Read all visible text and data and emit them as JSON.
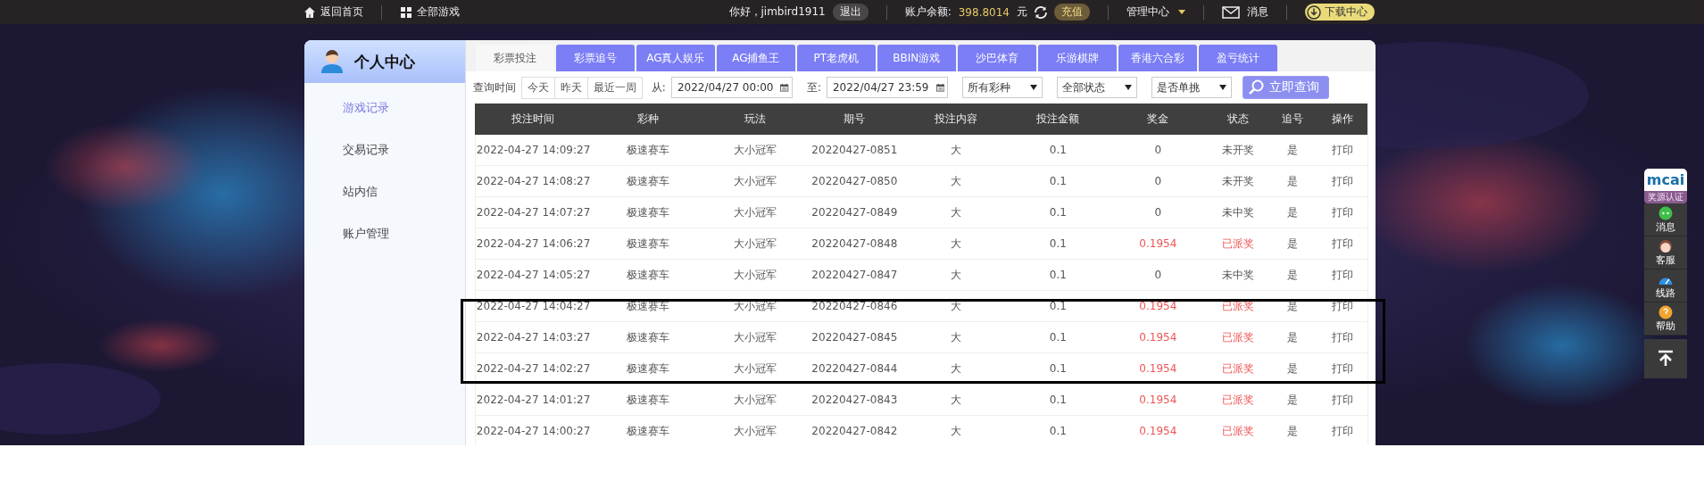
{
  "topbar": {
    "home": "返回首页",
    "all_games": "全部游戏",
    "greeting": "你好，jimbird1911",
    "logout": "退出",
    "balance_label": "账户余额:",
    "balance": "398.8014",
    "currency": "元",
    "recharge": "充值",
    "manage": "管理中心",
    "messages": "消息",
    "download": "下载中心"
  },
  "sidebar": {
    "title": "个人中心",
    "items": [
      {
        "label": "游戏记录",
        "selected": true
      },
      {
        "label": "交易记录",
        "selected": false
      },
      {
        "label": "站内信",
        "selected": false
      },
      {
        "label": "账户管理",
        "selected": false
      }
    ]
  },
  "tabs": [
    {
      "label": "彩票投注",
      "selected": true
    },
    {
      "label": "彩票追号",
      "selected": false
    },
    {
      "label": "AG真人娱乐",
      "selected": false
    },
    {
      "label": "AG捕鱼王",
      "selected": false
    },
    {
      "label": "PT老虎机",
      "selected": false
    },
    {
      "label": "BBIN游戏",
      "selected": false
    },
    {
      "label": "沙巴体育",
      "selected": false
    },
    {
      "label": "乐游棋牌",
      "selected": false
    },
    {
      "label": "香港六合彩",
      "selected": false
    },
    {
      "label": "盈亏统计",
      "selected": false
    }
  ],
  "filter": {
    "label": "查询时间",
    "quick": [
      "今天",
      "昨天",
      "最近一周"
    ],
    "from_label": "从:",
    "from": "2022/04/27 00:00",
    "to_label": "至:",
    "to": "2022/04/27 23:59",
    "selects": [
      "所有彩种",
      "全部状态",
      "是否单挑"
    ],
    "search": "立即查询"
  },
  "table": {
    "columns": [
      "投注时间",
      "彩种",
      "玩法",
      "期号",
      "投注内容",
      "投注金额",
      "奖金",
      "状态",
      "追号",
      "操作"
    ],
    "rows": [
      {
        "time": "2022-04-27 14:09:27",
        "lottery": "极速赛车",
        "play": "大小冠军",
        "issue": "20220427-0851",
        "content": "大",
        "amount": "0.1",
        "prize": "0",
        "status": "未开奖",
        "chase": "是",
        "action": "打印",
        "paid": false
      },
      {
        "time": "2022-04-27 14:08:27",
        "lottery": "极速赛车",
        "play": "大小冠军",
        "issue": "20220427-0850",
        "content": "大",
        "amount": "0.1",
        "prize": "0",
        "status": "未开奖",
        "chase": "是",
        "action": "打印",
        "paid": false
      },
      {
        "time": "2022-04-27 14:07:27",
        "lottery": "极速赛车",
        "play": "大小冠军",
        "issue": "20220427-0849",
        "content": "大",
        "amount": "0.1",
        "prize": "0",
        "status": "未中奖",
        "chase": "是",
        "action": "打印",
        "paid": false
      },
      {
        "time": "2022-04-27 14:06:27",
        "lottery": "极速赛车",
        "play": "大小冠军",
        "issue": "20220427-0848",
        "content": "大",
        "amount": "0.1",
        "prize": "0.1954",
        "status": "已派奖",
        "chase": "是",
        "action": "打印",
        "paid": true
      },
      {
        "time": "2022-04-27 14:05:27",
        "lottery": "极速赛车",
        "play": "大小冠军",
        "issue": "20220427-0847",
        "content": "大",
        "amount": "0.1",
        "prize": "0",
        "status": "未中奖",
        "chase": "是",
        "action": "打印",
        "paid": false
      },
      {
        "time": "2022-04-27 14:04:27",
        "lottery": "极速赛车",
        "play": "大小冠军",
        "issue": "20220427-0846",
        "content": "大",
        "amount": "0.1",
        "prize": "0.1954",
        "status": "已派奖",
        "chase": "是",
        "action": "打印",
        "paid": true
      },
      {
        "time": "2022-04-27 14:03:27",
        "lottery": "极速赛车",
        "play": "大小冠军",
        "issue": "20220427-0845",
        "content": "大",
        "amount": "0.1",
        "prize": "0.1954",
        "status": "已派奖",
        "chase": "是",
        "action": "打印",
        "paid": true
      },
      {
        "time": "2022-04-27 14:02:27",
        "lottery": "极速赛车",
        "play": "大小冠军",
        "issue": "20220427-0844",
        "content": "大",
        "amount": "0.1",
        "prize": "0.1954",
        "status": "已派奖",
        "chase": "是",
        "action": "打印",
        "paid": true
      },
      {
        "time": "2022-04-27 14:01:27",
        "lottery": "极速赛车",
        "play": "大小冠军",
        "issue": "20220427-0843",
        "content": "大",
        "amount": "0.1",
        "prize": "0.1954",
        "status": "已派奖",
        "chase": "是",
        "action": "打印",
        "paid": true
      },
      {
        "time": "2022-04-27 14:00:27",
        "lottery": "极速赛车",
        "play": "大小冠军",
        "issue": "20220427-0842",
        "content": "大",
        "amount": "0.1",
        "prize": "0.1954",
        "status": "已派奖",
        "chase": "是",
        "action": "打印",
        "paid": true
      }
    ]
  },
  "float_bar": {
    "logo": "mcai",
    "badge": "奖源认证",
    "items": [
      {
        "label": "消息",
        "kind": "chat"
      },
      {
        "label": "客服",
        "kind": "service"
      },
      {
        "label": "线路",
        "kind": "route"
      },
      {
        "label": "帮助",
        "kind": "help"
      }
    ]
  }
}
